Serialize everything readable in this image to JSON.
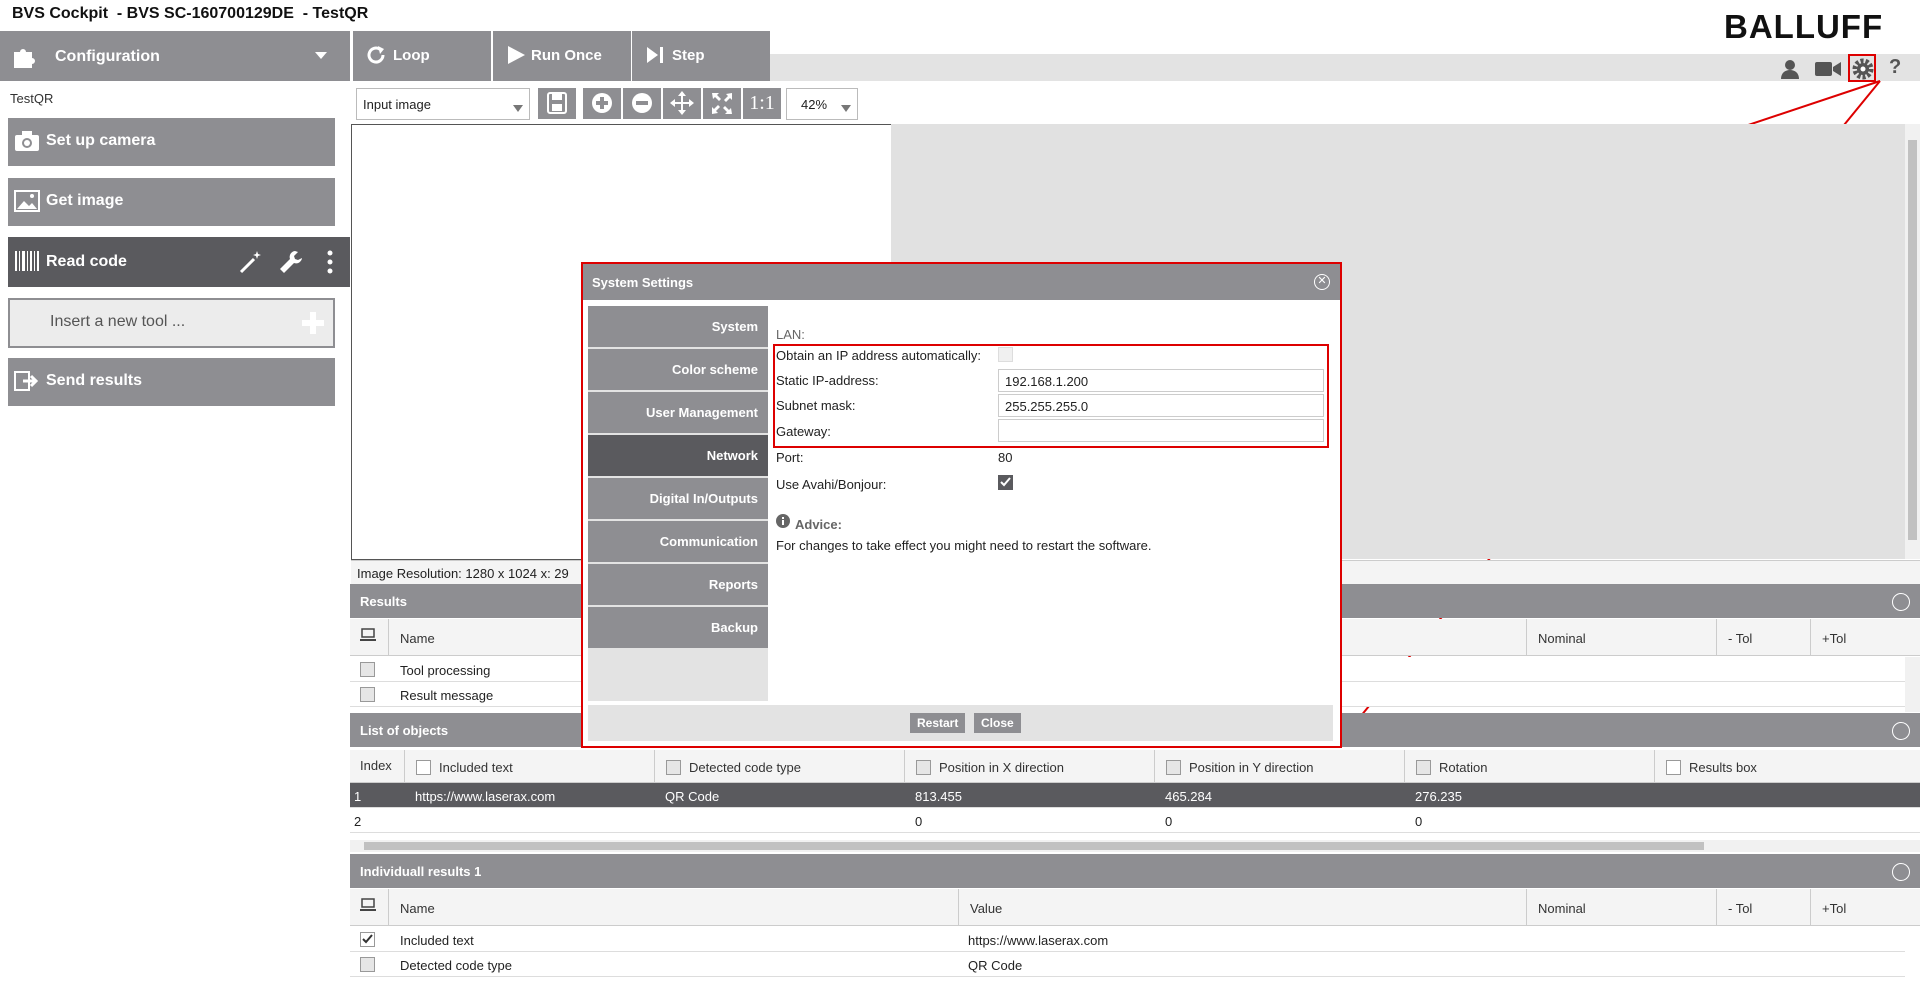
{
  "app": {
    "title": "BVS Cockpit  - BVS SC-160700129DE  - TestQR",
    "brand": "BALLUFF"
  },
  "toolbar": {
    "configuration_label": "Configuration",
    "loop_label": "Loop",
    "run_once_label": "Run Once",
    "step_label": "Step",
    "icons": [
      "user-icon",
      "video-icon",
      "gear-icon",
      "help-icon"
    ],
    "help_label": "?"
  },
  "sidebar": {
    "project": "TestQR",
    "items": [
      {
        "label": "Set up camera",
        "icon": "camera-icon"
      },
      {
        "label": "Get image",
        "icon": "image-icon"
      },
      {
        "label": "Read code",
        "icon": "barcode-icon"
      },
      {
        "label": "Insert a new tool ...",
        "icon": "plus-icon"
      },
      {
        "label": "Send results",
        "icon": "export-icon"
      }
    ]
  },
  "view": {
    "image_select": "Input image",
    "one_to_one": "1:1",
    "zoom": "42%",
    "status": "Image Resolution: 1280 x 1024   x: 29"
  },
  "results": {
    "title": "Results",
    "columns": {
      "name": "Name",
      "nominal": "Nominal",
      "minus_tol": "- Tol",
      "plus_tol": "+Tol"
    },
    "rows": [
      {
        "name": "Tool processing"
      },
      {
        "name": "Result message"
      }
    ]
  },
  "objects": {
    "title": "List of objects",
    "columns": [
      "Index",
      "Included text",
      "Detected code type",
      "Position in X direction",
      "Position in Y direction",
      "Rotation",
      "Results box"
    ],
    "rows": [
      {
        "index": "1",
        "text": "https://www.laserax.com",
        "type": "QR Code",
        "x": "813.455",
        "y": "465.284",
        "rot": "276.235"
      },
      {
        "index": "2",
        "text": "",
        "type": "",
        "x": "0",
        "y": "0",
        "rot": "0"
      }
    ]
  },
  "individual": {
    "title": "Individuall results 1",
    "columns": {
      "name": "Name",
      "value": "Value",
      "nominal": "Nominal",
      "minus_tol": "- Tol",
      "plus_tol": "+Tol"
    },
    "rows": [
      {
        "name": "Included text",
        "value": "https://www.laserax.com",
        "checked": true
      },
      {
        "name": "Detected code type",
        "value": "QR Code",
        "checked": false
      }
    ]
  },
  "dialog": {
    "title": "System Settings",
    "nav": [
      "System",
      "Color scheme",
      "User Management",
      "Network",
      "Digital In/Outputs",
      "Communication",
      "Reports",
      "Backup"
    ],
    "selected": "Network",
    "section": "LAN:",
    "obtain_auto_label": "Obtain an IP address automatically:",
    "static_ip_label": "Static IP-address:",
    "static_ip": "192.168.1.200",
    "subnet_label": "Subnet mask:",
    "subnet": "255.255.255.0",
    "gateway_label": "Gateway:",
    "gateway": "",
    "port_label": "Port:",
    "port": "80",
    "avahi_label": "Use Avahi/Bonjour:",
    "advice_title": "Advice:",
    "advice_text": "For changes to take effect you might need to restart the software.",
    "restart_label": "Restart",
    "close_label": "Close"
  },
  "colors": {
    "accent_grey": "#8e8e92",
    "dark_grey": "#5a5a5e",
    "highlight_red": "#dd0000"
  }
}
